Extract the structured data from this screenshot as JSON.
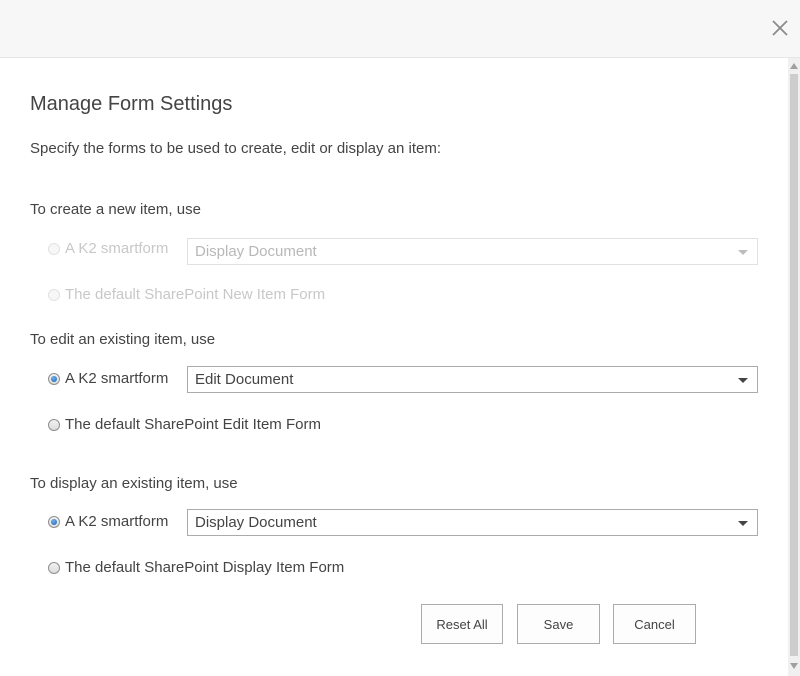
{
  "dialog": {
    "title": "Manage Form Settings",
    "intro": "Specify the forms to be used to create, edit or display an item:"
  },
  "sections": {
    "create": {
      "label": "To create a new item, use",
      "smartform_option": "A K2 smartform",
      "dropdown_value": "Display Document",
      "default_option": "The default SharePoint New Item Form",
      "enabled": false
    },
    "edit": {
      "label": "To edit an existing item, use",
      "smartform_option": "A K2 smartform",
      "dropdown_value": "Edit Document",
      "default_option": "The default SharePoint Edit Item Form",
      "selected": "smartform"
    },
    "display": {
      "label": "To display an existing item, use",
      "smartform_option": "A K2 smartform",
      "dropdown_value": "Display Document",
      "default_option": "The default SharePoint Display Item Form",
      "selected": "smartform"
    }
  },
  "buttons": {
    "reset_all": "Reset All",
    "save": "Save",
    "cancel": "Cancel"
  },
  "icons": {
    "close": "close-icon",
    "dropdown": "chevron-down-icon"
  },
  "colors": {
    "text": "#444444",
    "disabled_text": "#c8c8c8",
    "radio_selected": "#1c5fb0",
    "titlebar": "#f7f7f7"
  }
}
